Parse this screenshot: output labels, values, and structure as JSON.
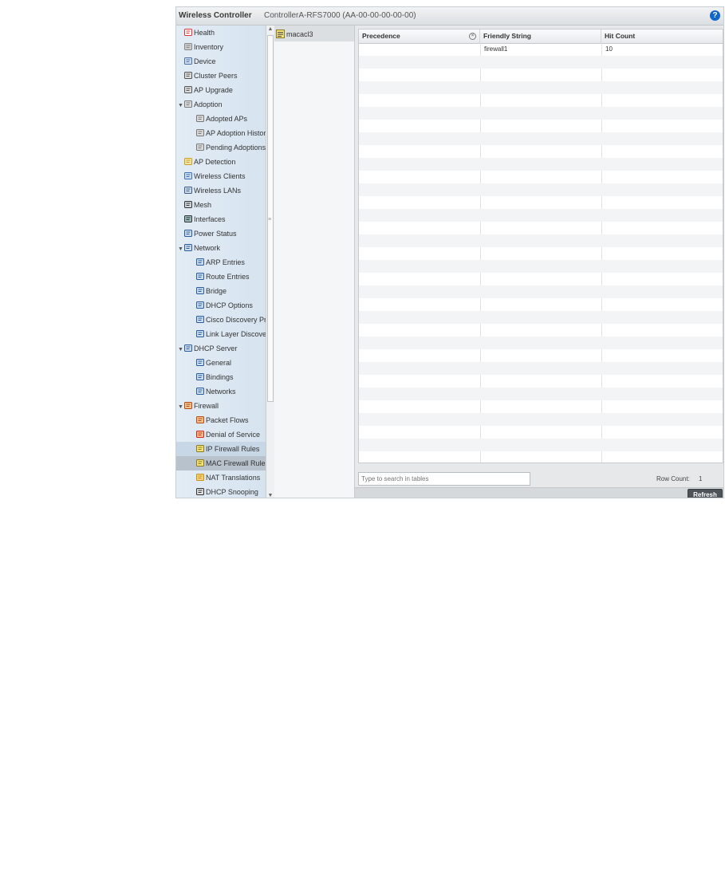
{
  "header": {
    "app_title": "Wireless Controller",
    "device_title": "ControllerA-RFS7000 (AA-00-00-00-00-00)",
    "help_label": "?"
  },
  "tree": {
    "items": [
      {
        "label": "Health",
        "icon": "health-icon",
        "indent": 0,
        "expander": ""
      },
      {
        "label": "Inventory",
        "icon": "inventory-icon",
        "indent": 0,
        "expander": ""
      },
      {
        "label": "Device",
        "icon": "device-icon",
        "indent": 0,
        "expander": ""
      },
      {
        "label": "Cluster Peers",
        "icon": "cluster-peers-icon",
        "indent": 0,
        "expander": ""
      },
      {
        "label": "AP Upgrade",
        "icon": "ap-upgrade-icon",
        "indent": 0,
        "expander": ""
      },
      {
        "label": "Adoption",
        "icon": "adoption-icon",
        "indent": 0,
        "expander": "▼"
      },
      {
        "label": "Adopted APs",
        "icon": "adopted-aps-icon",
        "indent": 1,
        "expander": ""
      },
      {
        "label": "AP Adoption History",
        "icon": "ap-adoption-history-icon",
        "indent": 1,
        "expander": ""
      },
      {
        "label": "Pending Adoptions",
        "icon": "pending-adoptions-icon",
        "indent": 1,
        "expander": ""
      },
      {
        "label": "AP Detection",
        "icon": "ap-detection-icon",
        "indent": 0,
        "expander": ""
      },
      {
        "label": "Wireless Clients",
        "icon": "wireless-clients-icon",
        "indent": 0,
        "expander": ""
      },
      {
        "label": "Wireless LANs",
        "icon": "wireless-lans-icon",
        "indent": 0,
        "expander": ""
      },
      {
        "label": "Mesh",
        "icon": "mesh-icon",
        "indent": 0,
        "expander": ""
      },
      {
        "label": "Interfaces",
        "icon": "interfaces-icon",
        "indent": 0,
        "expander": ""
      },
      {
        "label": "Power Status",
        "icon": "power-status-icon",
        "indent": 0,
        "expander": ""
      },
      {
        "label": "Network",
        "icon": "network-icon",
        "indent": 0,
        "expander": "▼"
      },
      {
        "label": "ARP Entries",
        "icon": "arp-entries-icon",
        "indent": 1,
        "expander": ""
      },
      {
        "label": "Route Entries",
        "icon": "route-entries-icon",
        "indent": 1,
        "expander": ""
      },
      {
        "label": "Bridge",
        "icon": "bridge-icon",
        "indent": 1,
        "expander": ""
      },
      {
        "label": "DHCP Options",
        "icon": "dhcp-options-icon",
        "indent": 1,
        "expander": ""
      },
      {
        "label": "Cisco Discovery Prot",
        "icon": "cisco-discovery-icon",
        "indent": 1,
        "expander": ""
      },
      {
        "label": "Link Layer Discovery",
        "icon": "link-layer-discovery-icon",
        "indent": 1,
        "expander": ""
      },
      {
        "label": "DHCP Server",
        "icon": "dhcp-server-icon",
        "indent": 0,
        "expander": "▼"
      },
      {
        "label": "General",
        "icon": "general-icon",
        "indent": 1,
        "expander": ""
      },
      {
        "label": "Bindings",
        "icon": "bindings-icon",
        "indent": 1,
        "expander": ""
      },
      {
        "label": "Networks",
        "icon": "networks-icon",
        "indent": 1,
        "expander": ""
      },
      {
        "label": "Firewall",
        "icon": "firewall-icon",
        "indent": 0,
        "expander": "▼"
      },
      {
        "label": "Packet Flows",
        "icon": "packet-flows-icon",
        "indent": 1,
        "expander": ""
      },
      {
        "label": "Denial of Service",
        "icon": "denial-of-service-icon",
        "indent": 1,
        "expander": ""
      },
      {
        "label": "IP Firewall Rules",
        "icon": "ip-firewall-rules-icon",
        "indent": 1,
        "expander": ""
      },
      {
        "label": "MAC Firewall Rules",
        "icon": "mac-firewall-rules-icon",
        "indent": 1,
        "expander": ""
      },
      {
        "label": "NAT Translations",
        "icon": "nat-translations-icon",
        "indent": 1,
        "expander": ""
      },
      {
        "label": "DHCP Snooping",
        "icon": "dhcp-snooping-icon",
        "indent": 1,
        "expander": ""
      }
    ],
    "highlighted_index": 29,
    "selected_index": 30
  },
  "device_list": {
    "items": [
      {
        "label": "macacl3",
        "icon": "access-list-icon"
      }
    ]
  },
  "table": {
    "columns": [
      "Precedence",
      "Friendly String",
      "Hit Count"
    ],
    "rows": [
      [
        "",
        "firewall1",
        "10"
      ]
    ],
    "empty_row_count": 32
  },
  "footer": {
    "search_placeholder": "Type to search in tables",
    "row_count_label": "Row Count:",
    "row_count_value": "1",
    "refresh_label": "Refresh"
  },
  "colors": {
    "accent_help": "#1166cc",
    "tree_bg": "#dbe6f1",
    "refresh_bg": "#4d5359"
  }
}
